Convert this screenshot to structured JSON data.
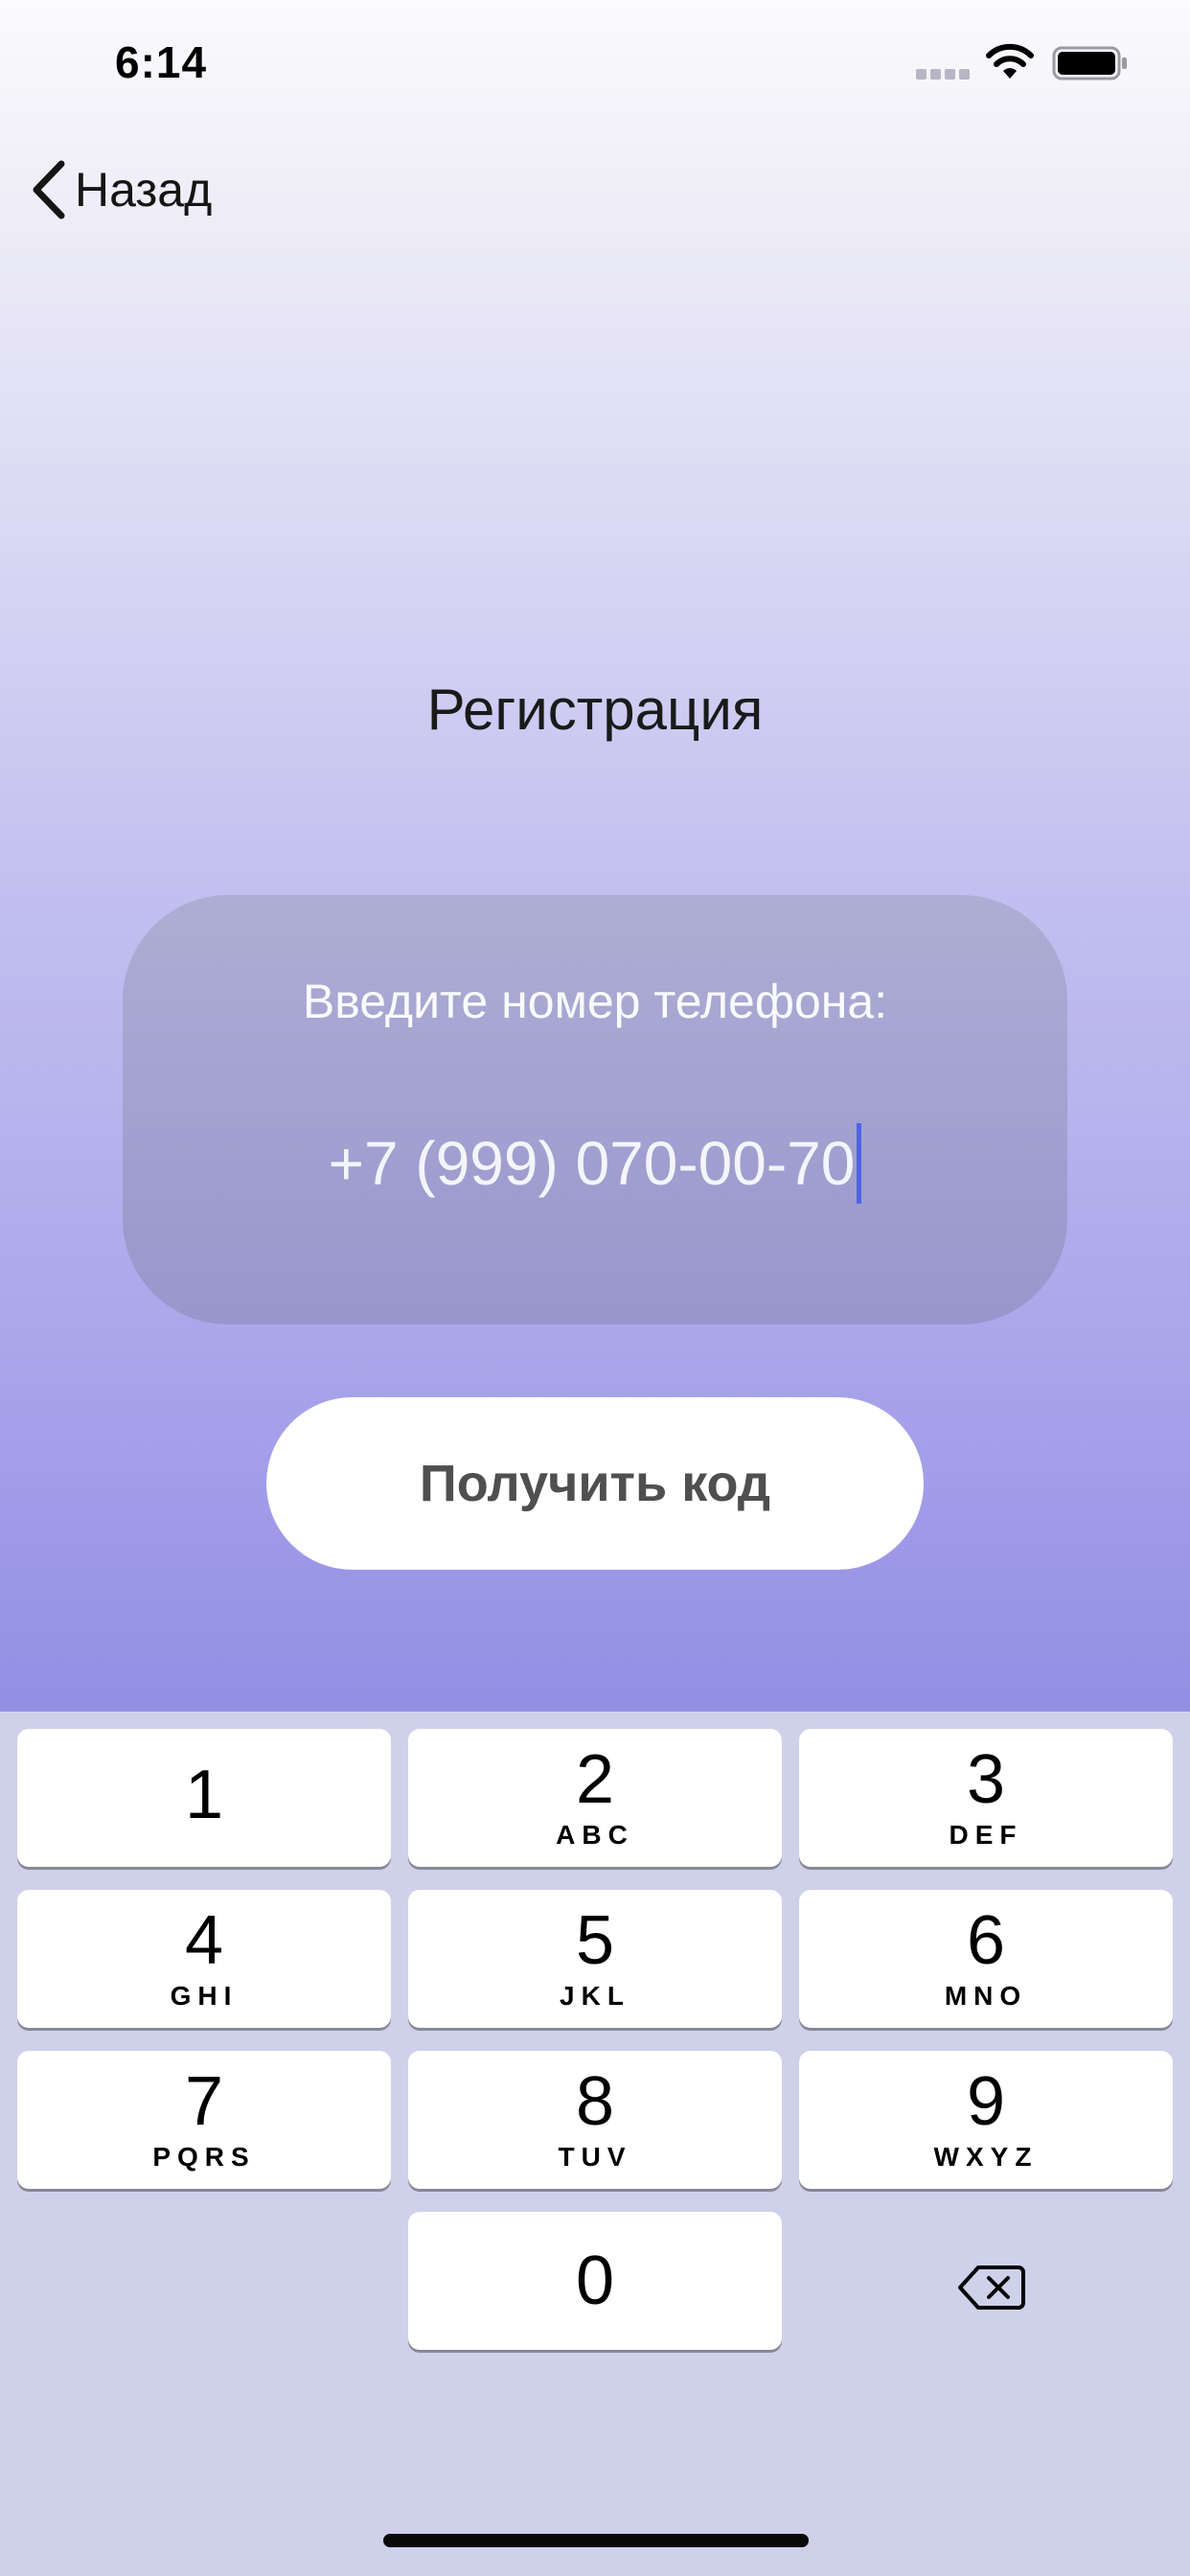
{
  "status_bar": {
    "time": "6:14",
    "signal_icon": "cellular-signal-icon",
    "wifi_icon": "wifi-icon",
    "battery_icon": "battery-icon"
  },
  "nav": {
    "back_label": "Назад",
    "back_icon": "chevron-left-icon"
  },
  "screen": {
    "title": "Регистрация"
  },
  "phone_card": {
    "label": "Введите номер телефона:",
    "phone_value": "+7 (999) 070-00-70"
  },
  "action": {
    "get_code_label": "Получить код"
  },
  "keypad": {
    "keys": [
      {
        "num": "1",
        "letters": ""
      },
      {
        "num": "2",
        "letters": "ABC"
      },
      {
        "num": "3",
        "letters": "DEF"
      },
      {
        "num": "4",
        "letters": "GHI"
      },
      {
        "num": "5",
        "letters": "JKL"
      },
      {
        "num": "6",
        "letters": "MNO"
      },
      {
        "num": "7",
        "letters": "PQRS"
      },
      {
        "num": "8",
        "letters": "TUV"
      },
      {
        "num": "9",
        "letters": "WXYZ"
      },
      {
        "num": "0",
        "letters": ""
      }
    ],
    "delete_icon": "backspace-icon"
  },
  "colors": {
    "accent_caret": "#4d63e6",
    "gradient_bottom": "#928ee4",
    "keypad_bg": "#cfd0ea"
  }
}
